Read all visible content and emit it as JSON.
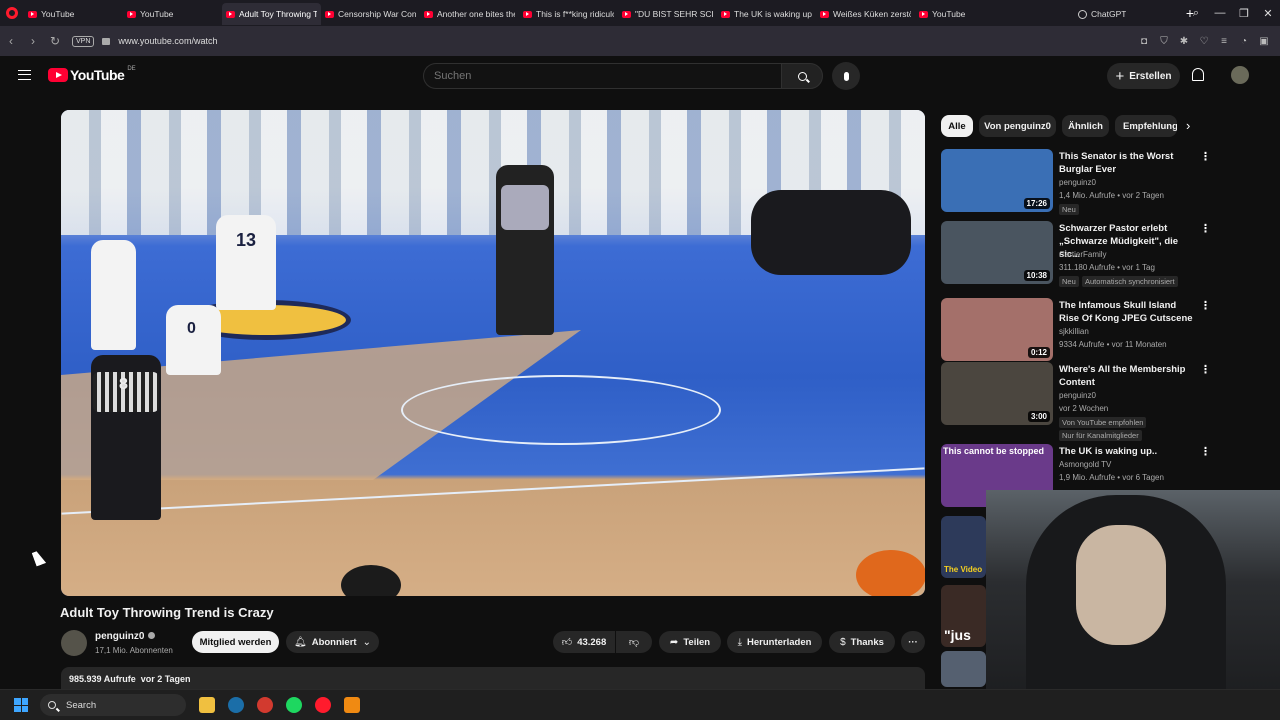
{
  "browser": {
    "tabs": [
      {
        "label": "YouTube",
        "icon": "youtube-icon",
        "active": false
      },
      {
        "label": "YouTube",
        "icon": "youtube-icon",
        "active": false
      },
      {
        "label": "Adult Toy Throwing Tr",
        "icon": "youtube-icon",
        "active": true
      },
      {
        "label": "Censorship War Conti",
        "icon": "youtube-icon",
        "active": false
      },
      {
        "label": "Another one bites the",
        "icon": "youtube-icon",
        "active": false
      },
      {
        "label": "This is f**king ridiculo",
        "icon": "youtube-icon",
        "active": false
      },
      {
        "label": "\"DU BIST SEHR SCHÖ",
        "icon": "youtube-icon",
        "active": false
      },
      {
        "label": "The UK is waking up..",
        "icon": "youtube-icon",
        "active": false
      },
      {
        "label": "Weißes Küken zerstört",
        "icon": "youtube-icon",
        "active": false
      },
      {
        "label": "YouTube",
        "icon": "youtube-icon",
        "active": false
      },
      {
        "label": "ChatGPT",
        "icon": "chatgpt-icon",
        "active": false
      }
    ],
    "new_tab_symbol": "+",
    "vpn_label": "VPN",
    "url": "www.youtube.com/watch"
  },
  "youtube": {
    "logo_text": "YouTube",
    "country_code": "DE",
    "search_placeholder": "Suchen",
    "create_label": "Erstellen"
  },
  "video": {
    "title": "Adult Toy Throwing Trend is Crazy",
    "channel_name": "penguinz0",
    "subscribers": "17,1 Mio. Abonnenten",
    "join_label": "Mitglied werden",
    "subscribed_label": "Abonniert",
    "likes": "43.268",
    "share_label": "Teilen",
    "download_label": "Herunterladen",
    "thanks_label": "Thanks",
    "views": "985.939 Aufrufe",
    "date": "vor 2 Tagen",
    "jersey_numbers": [
      "13",
      "0",
      "8"
    ]
  },
  "chips": [
    {
      "label": "Alle",
      "active": true
    },
    {
      "label": "Von penguinz0",
      "active": false
    },
    {
      "label": "Ähnlich",
      "active": false
    },
    {
      "label": "Empfehlung",
      "active": false
    }
  ],
  "recommendations": [
    {
      "title": "This Senator is the Worst Burglar Ever",
      "channel": "penguinz0",
      "meta": "1,4 Mio. Aufrufe • vor 2 Tagen",
      "badges": [
        "Neu"
      ],
      "duration": "17:26",
      "thumb_color": "#3a6fb5"
    },
    {
      "title": "Schwarzer Pastor erlebt „Schwarze Müdigkeit\", die sic...",
      "channel": "CartierFamily",
      "meta": "311.180 Aufrufe • vor 1 Tag",
      "badges": [
        "Neu",
        "Automatisch synchronisiert"
      ],
      "duration": "10:38",
      "thumb_color": "#4a5560"
    },
    {
      "title": "The Infamous Skull Island Rise Of Kong JPEG Cutscene",
      "channel": "sjkkillian",
      "meta": "9334 Aufrufe • vor 11 Monaten",
      "badges": [],
      "duration": "0:12",
      "thumb_color": "#a4706a"
    },
    {
      "title": "Where's All the Membership Content",
      "channel": "penguinz0",
      "meta": "vor 2 Wochen",
      "badges": [
        "Von YouTube empfohlen",
        "Nur für Kanalmitglieder"
      ],
      "duration": "3:00",
      "thumb_color": "#4b463f"
    },
    {
      "title": "The UK is waking up..",
      "channel": "Asmongold TV",
      "meta": "1,9 Mio. Aufrufe • vor 6 Tagen",
      "badges": [],
      "duration": "",
      "thumb_color": "#6a3a8a",
      "thumb_caption": "This cannot be stopped"
    }
  ],
  "partial_thumbs": [
    {
      "caption": "The Video",
      "color": "#2d3a5a"
    },
    {
      "caption": "\"jus",
      "color": "#3a2a25"
    },
    {
      "caption": "",
      "color": "#556070"
    }
  ],
  "taskbar": {
    "search_label": "Search",
    "icons": [
      "file-explorer-icon",
      "steam-icon",
      "chrome-icon",
      "spotify-icon",
      "opera-icon",
      "vlc-icon"
    ]
  }
}
